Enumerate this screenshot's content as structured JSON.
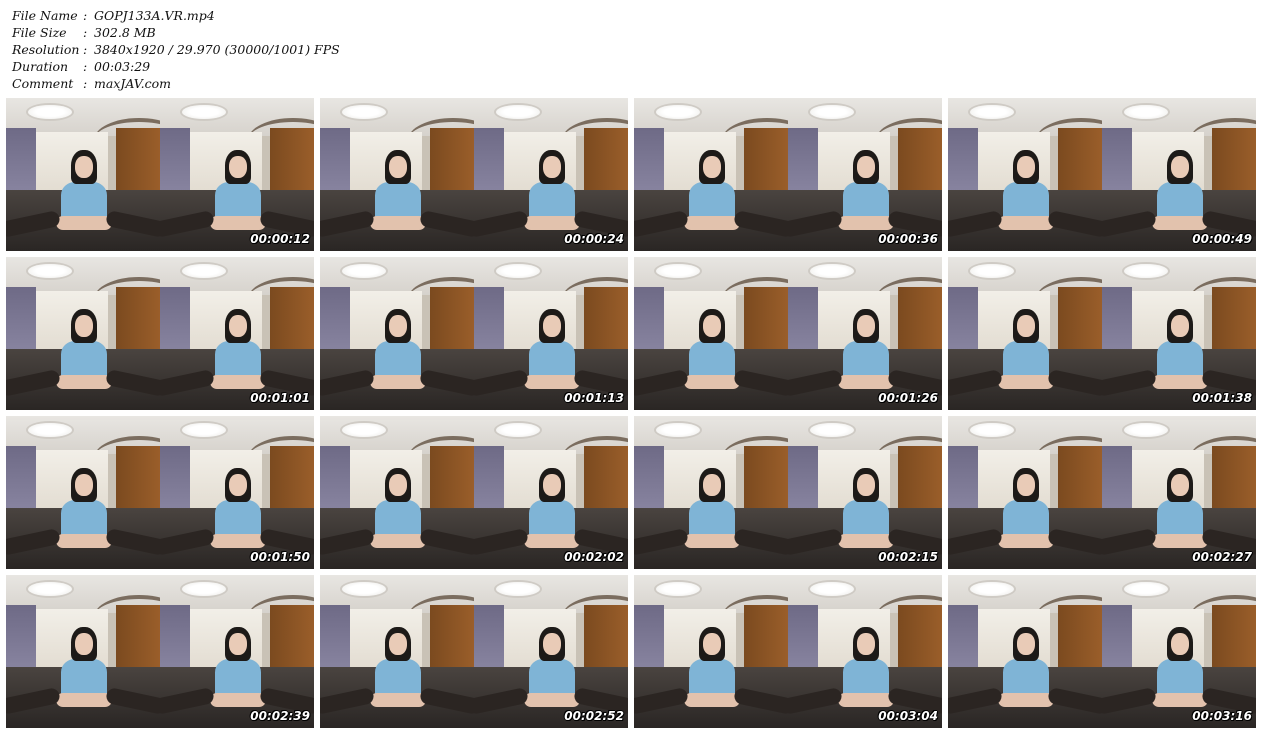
{
  "meta": {
    "rows": [
      {
        "key": "File Name",
        "sep": ":",
        "value": "GOPJ133A.VR.mp4"
      },
      {
        "key": "File Size",
        "sep": ":",
        "value": "302.8 MB"
      },
      {
        "key": "Resolution",
        "sep": ":",
        "value": "3840x1920 / 29.970 (30000/1001) FPS"
      },
      {
        "key": "Duration",
        "sep": ":",
        "value": "00:03:29"
      },
      {
        "key": "Comment",
        "sep": ":",
        "value": "maxJAV.com"
      }
    ]
  },
  "thumbnails": [
    {
      "time": "00:00:12"
    },
    {
      "time": "00:00:24"
    },
    {
      "time": "00:00:36"
    },
    {
      "time": "00:00:49"
    },
    {
      "time": "00:01:01"
    },
    {
      "time": "00:01:13"
    },
    {
      "time": "00:01:26"
    },
    {
      "time": "00:01:38"
    },
    {
      "time": "00:01:50"
    },
    {
      "time": "00:02:02"
    },
    {
      "time": "00:02:15"
    },
    {
      "time": "00:02:27"
    },
    {
      "time": "00:02:39"
    },
    {
      "time": "00:02:52"
    },
    {
      "time": "00:03:04"
    },
    {
      "time": "00:03:16"
    }
  ]
}
